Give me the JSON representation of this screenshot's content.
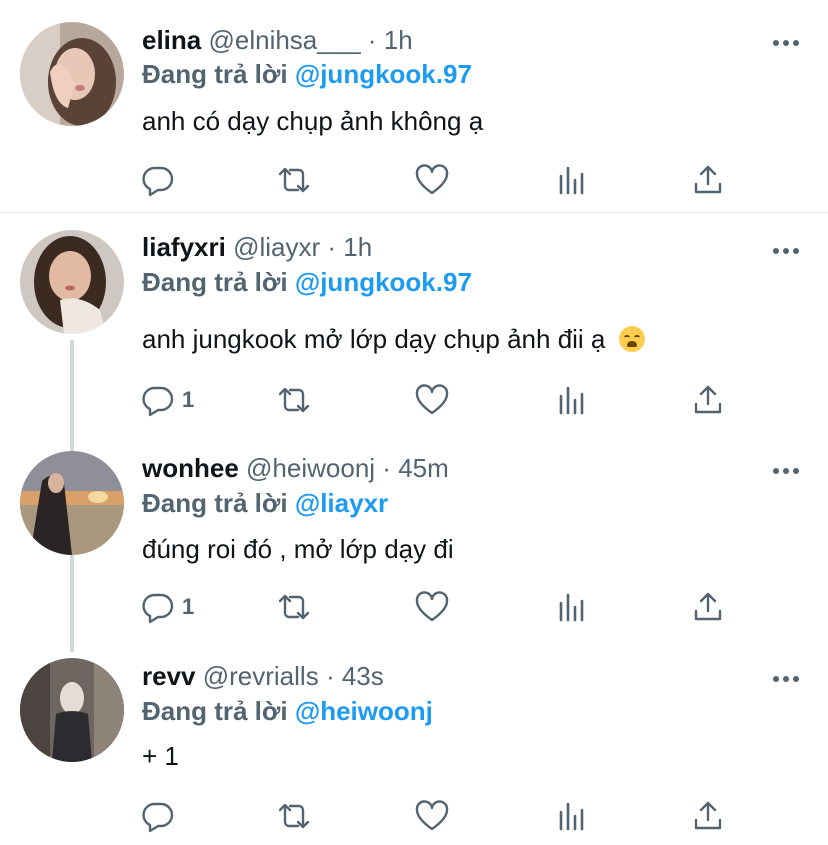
{
  "tweets": [
    {
      "name": "elina",
      "handle": "@elnihsa___",
      "time": "1h",
      "reply_prefix": "Đang trả lời",
      "reply_to": "@jungkook.97",
      "text": "anh có dạy chụp ảnh không ạ",
      "reply_count": "",
      "avatar": "girl-hand-face-avatar"
    },
    {
      "name": "liafyxri",
      "handle": "@liayxr",
      "time": "1h",
      "reply_prefix": "Đang trả lời",
      "reply_to": "@jungkook.97",
      "text": "anh jungkook mở lớp dạy chụp ảnh đii ạ",
      "emoji": "loudly-crying-face-emoji",
      "reply_count": "1",
      "avatar": "girl-chin-rest-avatar"
    },
    {
      "name": "wonhee",
      "handle": "@heiwoonj",
      "time": "45m",
      "reply_prefix": "Đang trả lời",
      "reply_to": "@liayxr",
      "text": "đúng roi đó , mở lớp dạy đi",
      "reply_count": "1",
      "avatar": "sunset-beach-avatar"
    },
    {
      "name": "revv",
      "handle": "@revrialls",
      "time": "43s",
      "reply_prefix": "Đang trả lời",
      "reply_to": "@heiwoonj",
      "text": "+ 1",
      "reply_count": "",
      "avatar": "street-photo-avatar"
    }
  ],
  "separator": "·",
  "icons": {
    "reply": "comment-icon",
    "retweet": "retweet-icon",
    "like": "heart-icon",
    "views": "analytics-icon",
    "share": "share-icon",
    "more": "more-dots-icon"
  },
  "colors": {
    "mention": "#1d9bf0",
    "muted": "#536471",
    "text": "#0f1419",
    "thread_line": "#cfd9de"
  }
}
